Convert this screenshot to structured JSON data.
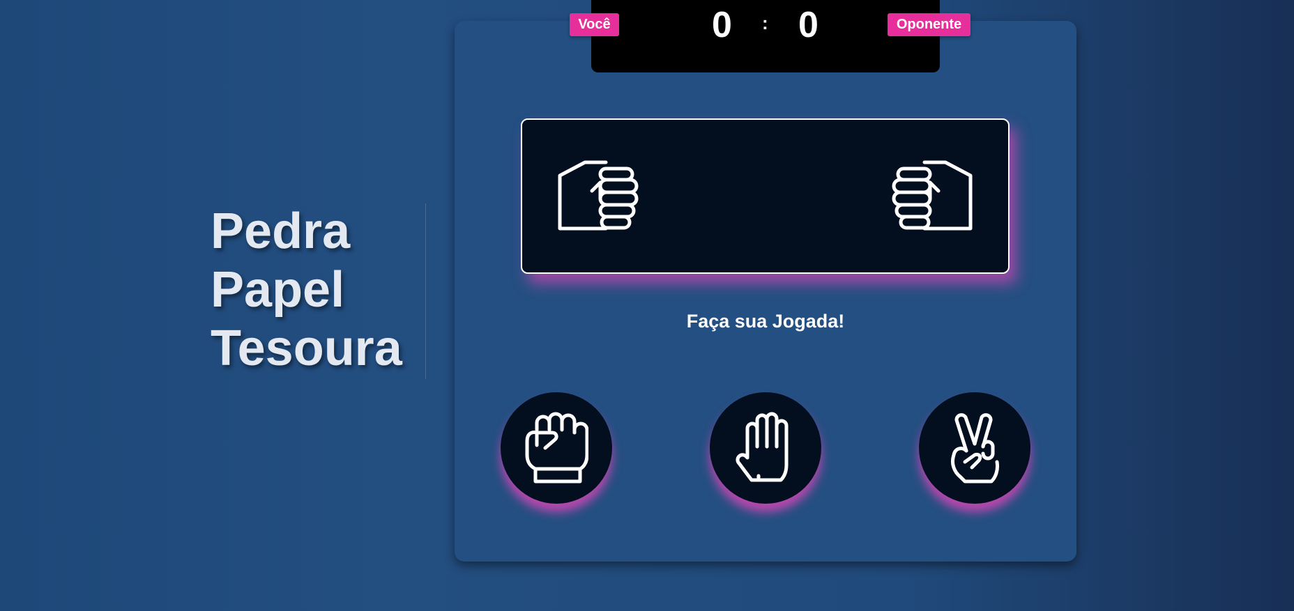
{
  "title": {
    "line1": "Pedra",
    "line2": "Papel",
    "line3": "Tesoura"
  },
  "score": {
    "player_label": "Você",
    "opponent_label": "Oponente",
    "player_score": "0",
    "separator": ":",
    "opponent_score": "0"
  },
  "arena": {
    "player_hand": "fist-right-icon",
    "opponent_hand": "fist-left-icon"
  },
  "prompt": "Faça sua Jogada!",
  "choices": [
    {
      "icon": "fist-icon"
    },
    {
      "icon": "open-hand-icon"
    },
    {
      "icon": "peace-hand-icon"
    }
  ],
  "colors": {
    "background": "#1f4a7c",
    "board": "#244f82",
    "panel": "#030f1f",
    "accent": "#e72f9b",
    "text": "#ffffff"
  }
}
